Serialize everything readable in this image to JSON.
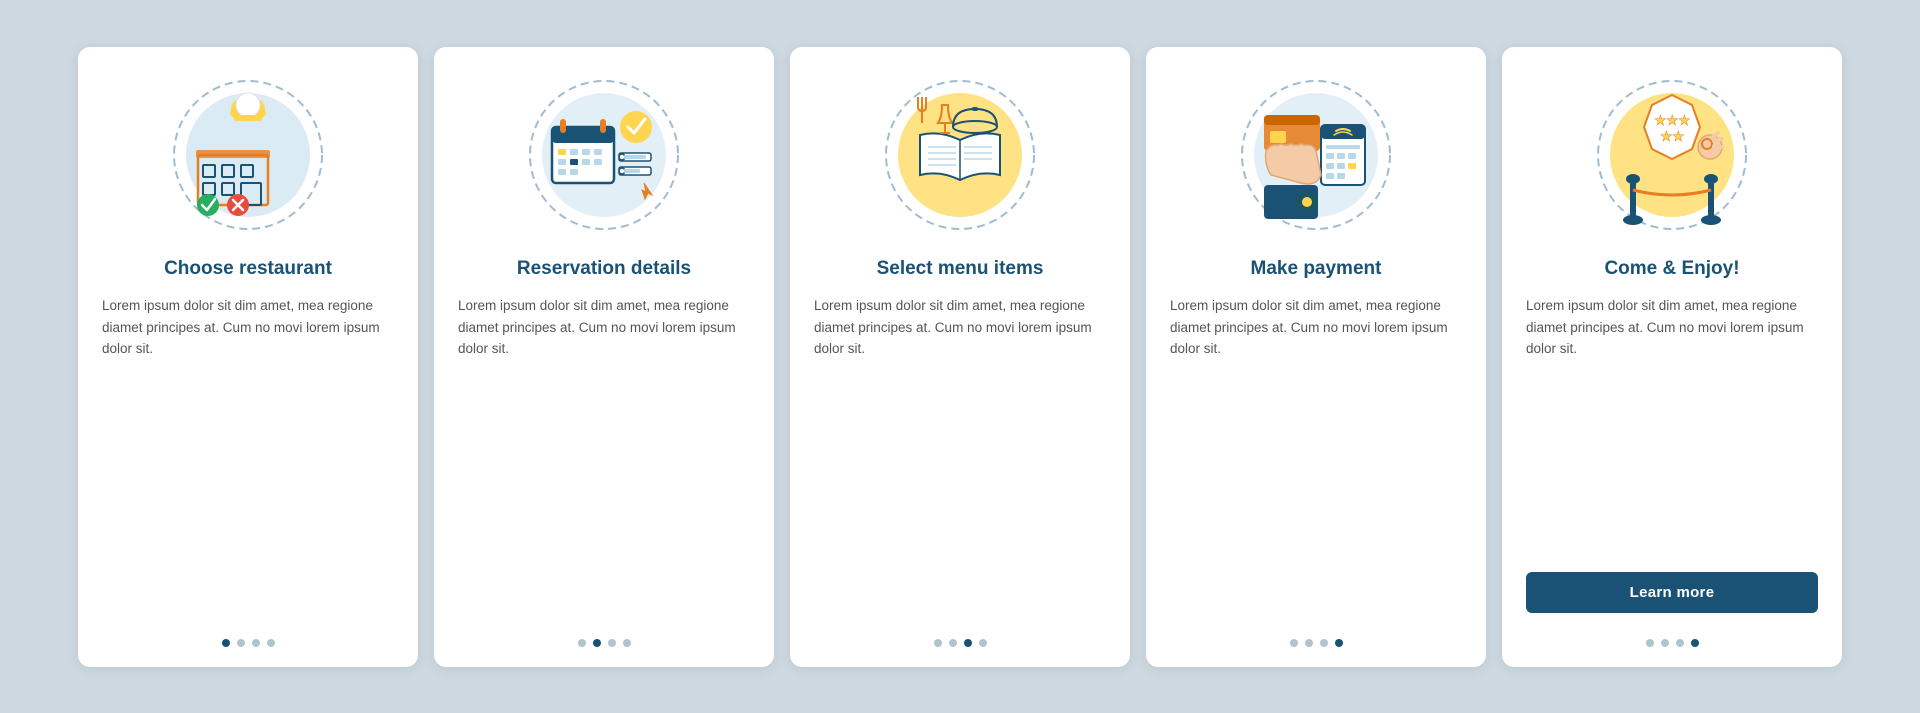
{
  "cards": [
    {
      "id": "choose-restaurant",
      "title": "Choose restaurant",
      "body": "Lorem ipsum dolor sit dim amet, mea regione diamet principes at. Cum no movi lorem ipsum dolor sit.",
      "dots": [
        true,
        false,
        false,
        false
      ],
      "icon_color_circle": "#b8d8ea",
      "accent_color": "#ffd54f",
      "has_button": false,
      "button_label": ""
    },
    {
      "id": "reservation-details",
      "title": "Reservation details",
      "body": "Lorem ipsum dolor sit dim amet, mea regione diamet principes at. Cum no movi lorem ipsum dolor sit.",
      "dots": [
        false,
        true,
        false,
        false
      ],
      "icon_color_circle": "#b8d8ea",
      "accent_color": "#ffd54f",
      "has_button": false,
      "button_label": ""
    },
    {
      "id": "select-menu-items",
      "title": "Select menu items",
      "body": "Lorem ipsum dolor sit dim amet, mea regione diamet principes at. Cum no movi lorem ipsum dolor sit.",
      "dots": [
        false,
        false,
        true,
        false
      ],
      "icon_color_circle": "#ffd54f",
      "accent_color": "#b8d8ea",
      "has_button": false,
      "button_label": ""
    },
    {
      "id": "make-payment",
      "title": "Make payment",
      "body": "Lorem ipsum dolor sit dim amet, mea regione diamet principes at. Cum no movi lorem ipsum dolor sit.",
      "dots": [
        false,
        false,
        false,
        true
      ],
      "icon_color_circle": "#b8d8ea",
      "accent_color": "#ffd54f",
      "has_button": false,
      "button_label": ""
    },
    {
      "id": "come-enjoy",
      "title": "Come & Enjoy!",
      "body": "Lorem ipsum dolor sit dim amet, mea regione diamet principes at. Cum no movi lorem ipsum dolor sit.",
      "dots": [
        false,
        false,
        false,
        true
      ],
      "icon_color_circle": "#ffd54f",
      "accent_color": "#b8d8ea",
      "has_button": true,
      "button_label": "Learn more"
    }
  ],
  "brand": {
    "accent_blue": "#1a5276",
    "accent_yellow": "#ffd54f",
    "accent_light_blue": "#b8d8ea"
  }
}
